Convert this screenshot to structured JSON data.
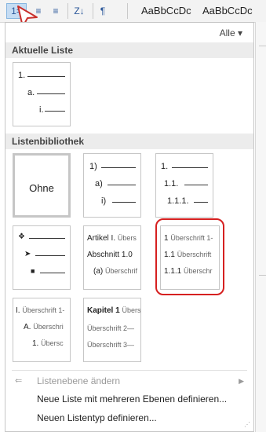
{
  "ribbon": {
    "buttons": [
      "1=",
      "≡",
      "≡",
      "Z↓",
      "¶"
    ],
    "styles": [
      "AaBbCcDc",
      "AaBbCcDc"
    ]
  },
  "panel": {
    "filter_label": "Alle",
    "current_header": "Aktuelle Liste",
    "library_header": "Listenbibliothek",
    "current": {
      "l1": "1.",
      "l2": "a.",
      "l3": "i."
    },
    "none_label": "Ohne",
    "tile_paren": {
      "l1": "1)",
      "l2": "a)",
      "l3": "i)"
    },
    "tile_decimal": {
      "l1": "1.",
      "l2": "1.1.",
      "l3": "1.1.1."
    },
    "tile_artikel": {
      "l1": "Artikel I.",
      "l1s": "Übers",
      "l2": "Abschnitt 1.0",
      "l3": "(a)",
      "l3s": "Überschrif"
    },
    "tile_heading_num": {
      "l1": "1",
      "l1s": "Überschrift 1-",
      "l2": "1.1",
      "l2s": "Überschrift",
      "l3": "1.1.1",
      "l3s": "Überschr"
    },
    "tile_roman": {
      "l1": "I.",
      "l1s": "Überschrift 1-",
      "l2": "A.",
      "l2s": "Überschri",
      "l3": "1.",
      "l3s": "Übersc"
    },
    "tile_kapitel": {
      "l1": "Kapitel 1",
      "l1s": "Übers",
      "l2": "Überschrift 2—",
      "l3": "Überschrift 3—"
    }
  },
  "menu": {
    "change_level": "Listenebene ändern",
    "define_multilevel": "Neue Liste mit mehreren Ebenen definieren...",
    "define_style": "Neuen Listentyp definieren..."
  }
}
